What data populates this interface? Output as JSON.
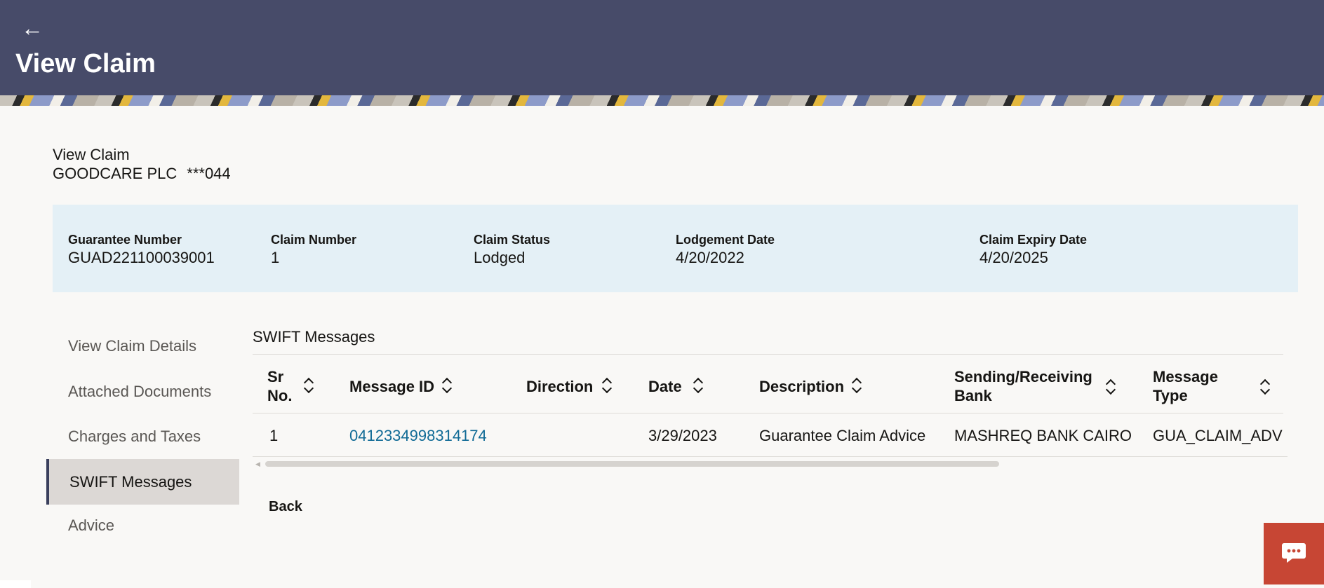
{
  "header": {
    "back_icon": "←",
    "title": "View Claim"
  },
  "subheader": {
    "title": "View Claim",
    "party_name": "GOODCARE PLC",
    "party_account": "***044"
  },
  "summary": [
    {
      "label": "Guarantee Number",
      "value": "GUAD221100039001"
    },
    {
      "label": "Claim Number",
      "value": "1"
    },
    {
      "label": "Claim Status",
      "value": "Lodged"
    },
    {
      "label": "Lodgement Date",
      "value": "4/20/2022"
    },
    {
      "label": "Claim Expiry Date",
      "value": "4/20/2025"
    }
  ],
  "sidebar": {
    "items": [
      {
        "label": "View Claim Details"
      },
      {
        "label": "Attached Documents"
      },
      {
        "label": "Charges and Taxes"
      },
      {
        "label": "SWIFT Messages",
        "active": true
      },
      {
        "label": "Advice"
      }
    ]
  },
  "swift": {
    "title": "SWIFT Messages",
    "columns": [
      {
        "label": "Sr No.",
        "line1": "Sr",
        "line2": "No."
      },
      {
        "label": "Message ID"
      },
      {
        "label": "Direction"
      },
      {
        "label": "Date"
      },
      {
        "label": "Description"
      },
      {
        "label": "Sending/Receiving Bank",
        "line1": "Sending/Receiving",
        "line2": "Bank"
      },
      {
        "label": "Message Type",
        "line1": "Message",
        "line2": "Type"
      }
    ],
    "rows": [
      {
        "sr_no": "1",
        "message_id": "0412334998314174",
        "direction": "",
        "date": "3/29/2023",
        "description": "Guarantee Claim Advice",
        "bank": "MASHREQ BANK CAIRO",
        "message_type": "GUA_CLAIM_ADV"
      }
    ]
  },
  "actions": {
    "back_label": "Back"
  },
  "icons": {
    "back": "arrow-left-icon",
    "sort": "sort-icon",
    "chat": "chat-icon"
  },
  "colors": {
    "header_bg": "#474b69",
    "info_band_bg": "#e4f0f6",
    "link": "#116b96",
    "chat_button": "#c74634",
    "active_nav_bg": "#dcd8d5"
  }
}
